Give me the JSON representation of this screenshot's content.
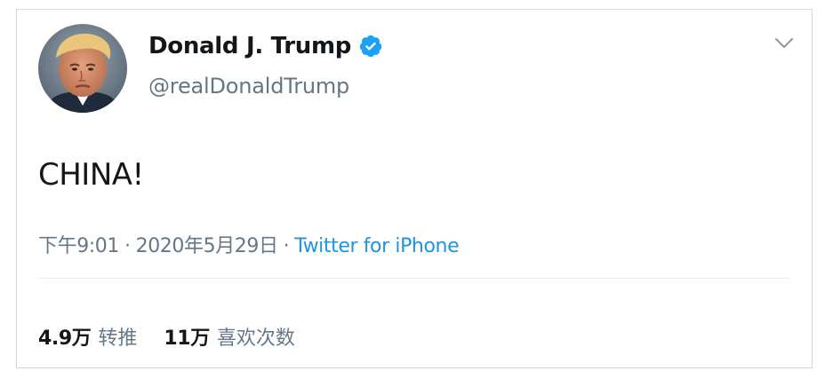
{
  "tweet": {
    "display_name": "Donald J. Trump",
    "handle": "@realDonaldTrump",
    "verified": true,
    "text": "CHINA!",
    "time": "下午9:01",
    "separator": "·",
    "date": "2020年5月29日",
    "source": "Twitter for iPhone",
    "stats": {
      "retweets_count": "4.9万",
      "retweets_label": "转推",
      "likes_count": "11万",
      "likes_label": "喜欢次数"
    }
  },
  "icons": {
    "verified": "verified-badge-icon",
    "caret": "chevron-down-icon",
    "avatar": "profile-avatar"
  },
  "colors": {
    "name": "#14171a",
    "secondary": "#657786",
    "link": "#1b95e0",
    "verified": "#1da1f2",
    "border": "#cfd5da"
  }
}
